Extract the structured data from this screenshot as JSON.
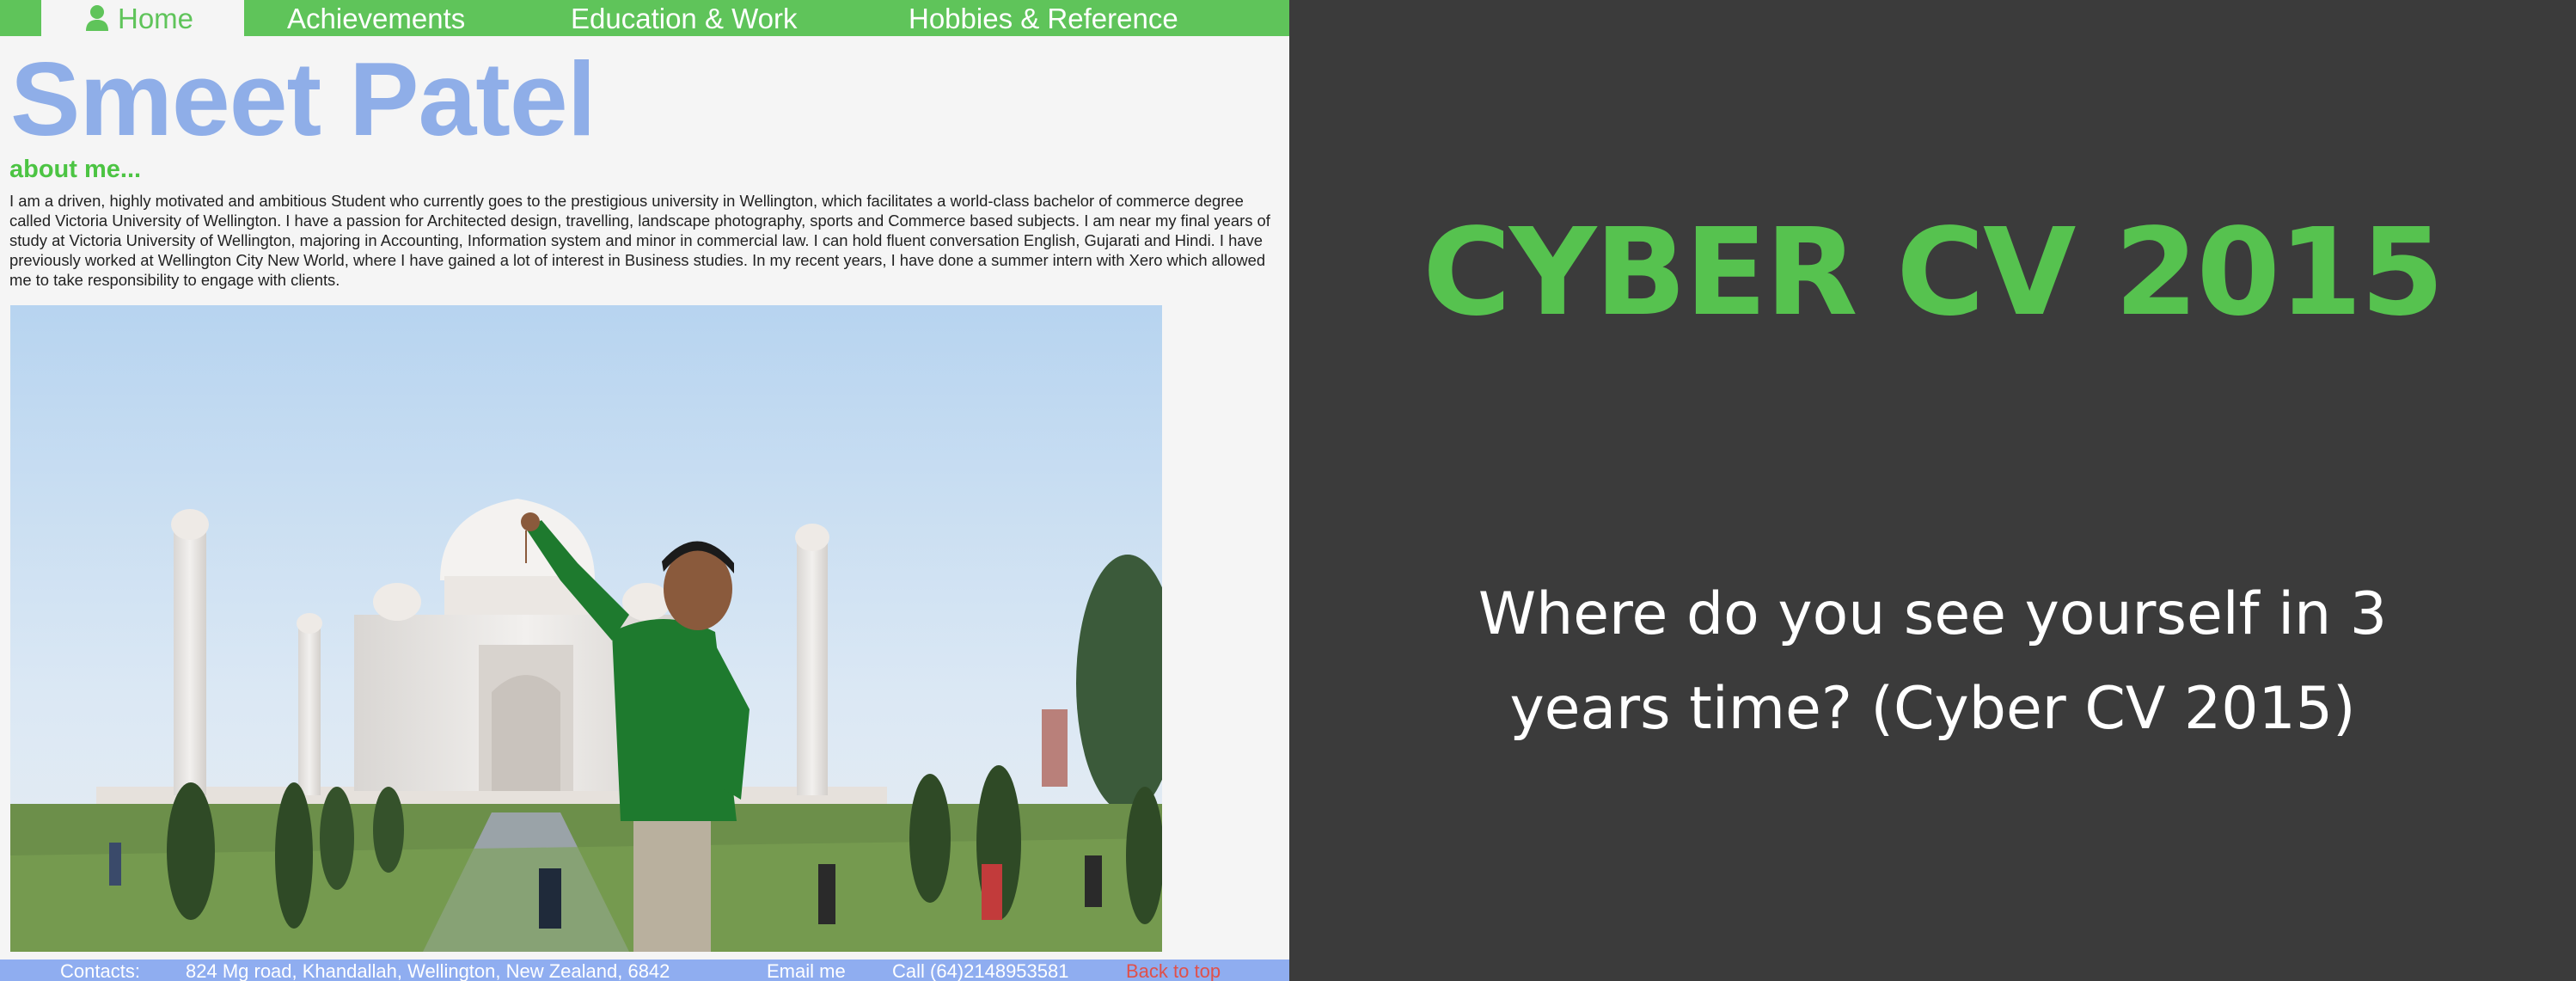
{
  "website": {
    "nav": {
      "home": "Home",
      "achievements": "Achievements",
      "education_work": "Education & Work",
      "hobbies_reference": "Hobbies & Reference"
    },
    "name": "Smeet Patel",
    "about_heading": "about me...",
    "about_text": "I am a driven, highly motivated and ambitious Student who currently goes to the prestigious university in Wellington, which facilitates a world-class bachelor of commerce degree called Victoria University of Wellington. I have a passion for Architected design, travelling, landscape photography, sports and Commerce based subjects. I am near my final years of study at Victoria University of Wellington, majoring in Accounting, Information system and minor in commercial law. I can hold fluent conversation English, Gujarati and Hindi. I have previously worked at Wellington City New World, where I have gained a lot of interest in Business studies. In my recent years, I have done a summer intern with Xero which allowed me to take responsibility to engage with clients.",
    "footer": {
      "contacts": "Contacts:",
      "address": "824 Mg road, Khandallah, Wellington, New Zealand, 6842",
      "email": "Email me",
      "call": "Call (64)2148953581",
      "back_to_top": "Back to top"
    },
    "colors": {
      "nav_green": "#5fc45a",
      "name_blue": "#8faee8",
      "footer_blue": "#8fadf0",
      "back_to_top_red": "#e0504a"
    },
    "icons": {
      "home": "user-icon"
    }
  },
  "card": {
    "title": "CYBER CV 2015",
    "subtitle": "Where do you see yourself in 3 years time? (Cyber CV 2015)",
    "colors": {
      "background": "#3b3b3b",
      "title": "#56c24f",
      "subtitle": "#ffffff"
    }
  }
}
